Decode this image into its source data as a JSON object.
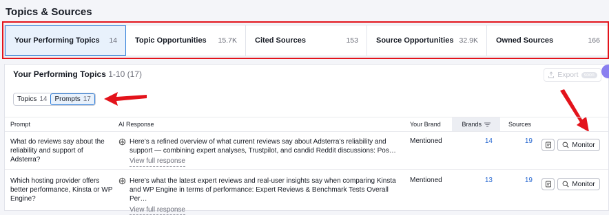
{
  "page": {
    "title": "Topics & Sources"
  },
  "tabs": [
    {
      "label": "Your Performing Topics",
      "count": "14"
    },
    {
      "label": "Topic Opportunities",
      "count": "15.7K"
    },
    {
      "label": "Cited Sources",
      "count": "153"
    },
    {
      "label": "Source Opportunities",
      "count": "32.9K"
    },
    {
      "label": "Owned Sources",
      "count": "166"
    }
  ],
  "panel": {
    "title": "Your Performing Topics",
    "range": "1-10 (17)",
    "export_label": "Export",
    "export_badge": "soon",
    "segments": [
      {
        "label": "Topics",
        "count": "14"
      },
      {
        "label": "Prompts",
        "count": "17"
      }
    ]
  },
  "table": {
    "headers": {
      "prompt": "Prompt",
      "ai_response": "AI Response",
      "your_brand": "Your Brand",
      "brands": "Brands",
      "sources": "Sources"
    },
    "rows": [
      {
        "prompt": "What do reviews say about the reliability and support of Adsterra?",
        "ai_response": "Here’s a refined overview of what current reviews say about Adsterra’s reliability and support — combining expert analyses, Trustpilot, and candid Reddit discussions: Pos…",
        "view_link": "View full response",
        "brand": "Mentioned",
        "brands": "14",
        "sources": "19",
        "monitor_label": "Monitor"
      },
      {
        "prompt": "Which hosting provider offers better performance, Kinsta or WP Engine?",
        "ai_response": "Here’s what the latest expert reviews and real-user insights say when comparing Kinsta and WP Engine in terms of performance: Expert Reviews & Benchmark Tests Overall Per…",
        "view_link": "View full response",
        "brand": "Mentioned",
        "brands": "13",
        "sources": "19",
        "monitor_label": "Monitor"
      }
    ]
  },
  "colors": {
    "accent": "#2b7bd8",
    "annotation_red": "#e3131b",
    "link_number": "#2b6ad1"
  }
}
